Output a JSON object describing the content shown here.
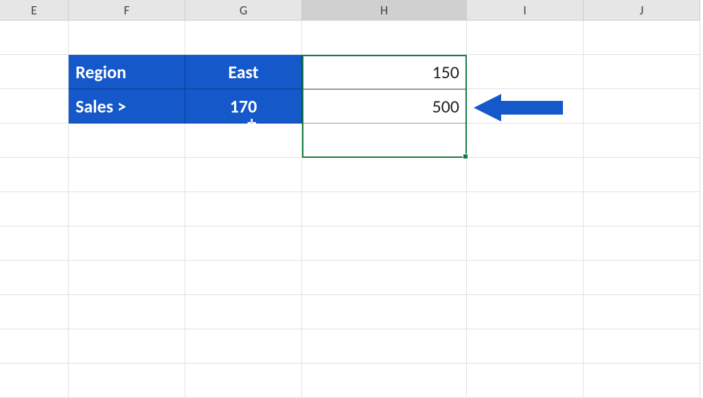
{
  "columns": [
    "E",
    "F",
    "G",
    "H",
    "I",
    "J"
  ],
  "active_column_index": 3,
  "rows": {
    "row2": {
      "F": "Region",
      "G": "East",
      "H": "150"
    },
    "row3": {
      "F": "Sales >",
      "G": "170",
      "H": "500"
    }
  },
  "colors": {
    "header_bg": "#1558c9",
    "arrow": "#1558c9",
    "selection": "#0f7b42"
  },
  "selection": {
    "range": "H2:H4",
    "active_cell": "H4"
  }
}
